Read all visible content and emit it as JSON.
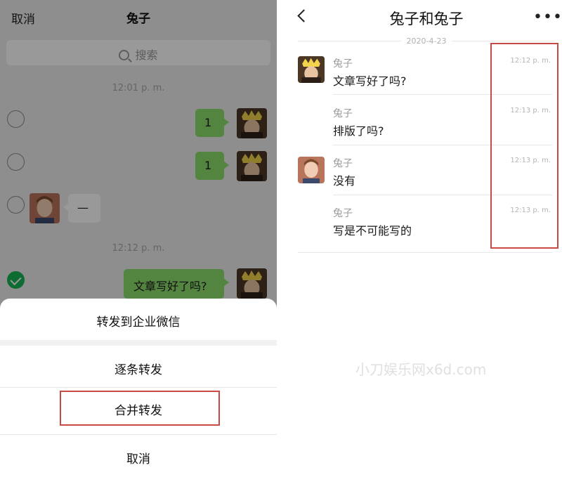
{
  "left": {
    "cancel_top": "取消",
    "chat_title": "兔子",
    "search_placeholder": "搜索",
    "timestamps": [
      "12:01 p. m.",
      "12:12 p. m."
    ],
    "messages": [
      {
        "side": "right",
        "text": "1",
        "selected": false
      },
      {
        "side": "right",
        "text": "1",
        "selected": false
      },
      {
        "side": "left",
        "text": "—",
        "selected": false
      },
      {
        "side": "right",
        "text": "文章写好了吗?",
        "selected": true
      }
    ],
    "sheet": {
      "forward_enterprise": "转发到企业微信",
      "forward_one_by_one": "逐条转发",
      "forward_merged": "合并转发",
      "cancel": "取消"
    },
    "highlight_color": "#c94a44",
    "bubble_color": "#8bdc6b",
    "check_color": "#16b454"
  },
  "right": {
    "title": "兔子和兔子",
    "more_icon": "more-icon",
    "date": "2020-4-23",
    "messages": [
      {
        "sender": "兔子",
        "text": "文章写好了吗?",
        "time": "12:12 p. m.",
        "avatar": "crown"
      },
      {
        "sender": "兔子",
        "text": "排版了吗?",
        "time": "12:13 p. m.",
        "avatar": ""
      },
      {
        "sender": "兔子",
        "text": "没有",
        "time": "12:13 p. m.",
        "avatar": "boy"
      },
      {
        "sender": "兔子",
        "text": "写是不可能写的",
        "time": "12:13 p. m.",
        "avatar": ""
      }
    ]
  },
  "watermark": "小刀娱乐网x6d.com"
}
